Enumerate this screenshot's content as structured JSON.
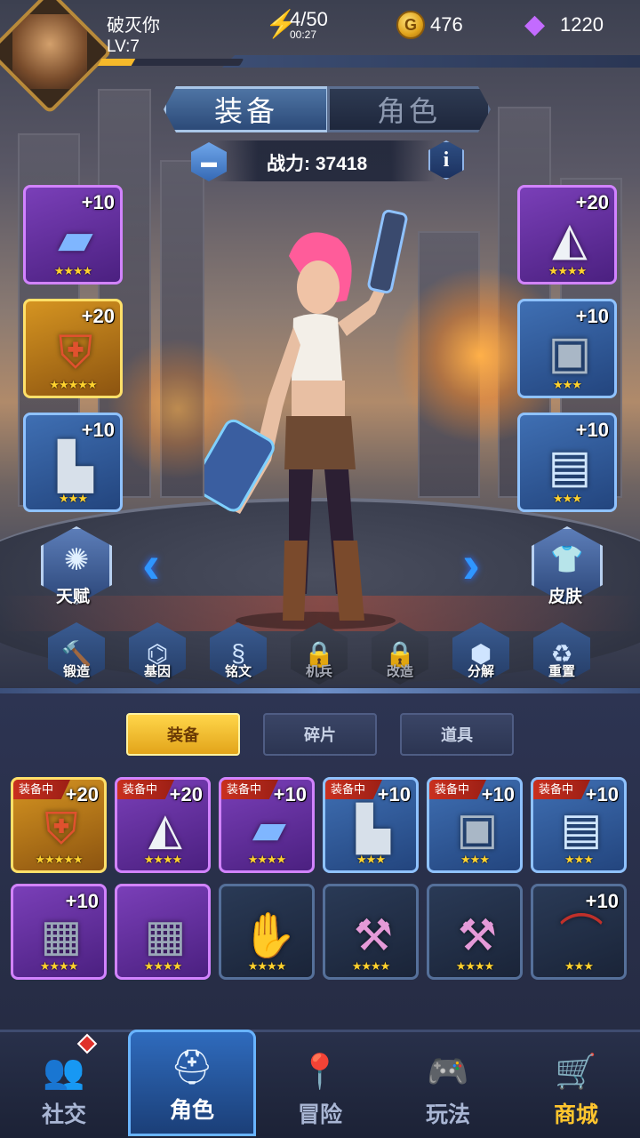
{
  "player": {
    "name": "破灭你",
    "level": "LV:7",
    "xp_fraction": 0.24
  },
  "resources": {
    "energy": {
      "value": "4/50",
      "timer": "00:27",
      "icon": "lightning-bolt-icon"
    },
    "gold": {
      "value": "476",
      "icon": "gold-coin-icon"
    },
    "gems": {
      "value": "1220",
      "icon": "purple-diamond-icon"
    }
  },
  "top_tabs": [
    {
      "label": "装备",
      "active": true
    },
    {
      "label": "角色",
      "active": false
    }
  ],
  "power": {
    "label": "战力:",
    "value": "37418"
  },
  "info_label": "i",
  "equipped_left": [
    {
      "plus": "+10",
      "stars": "★★★★",
      "quality": "purple",
      "item": "blaster-gun"
    },
    {
      "plus": "+20",
      "stars": "★★★★★",
      "quality": "gold",
      "item": "armor-vest"
    },
    {
      "plus": "+10",
      "stars": "★★★",
      "quality": "blue",
      "item": "boots"
    }
  ],
  "equipped_right": [
    {
      "plus": "+20",
      "stars": "★★★★",
      "quality": "purple",
      "item": "helmet"
    },
    {
      "plus": "+10",
      "stars": "★★★",
      "quality": "blue",
      "item": "gauntlet"
    },
    {
      "plus": "+10",
      "stars": "★★★",
      "quality": "blue",
      "item": "chip-card"
    }
  ],
  "side_buttons": {
    "talent": "天赋",
    "skin": "皮肤"
  },
  "actions": [
    {
      "label": "锻造",
      "icon": "hammer-icon",
      "locked": false
    },
    {
      "label": "基因",
      "icon": "dna-icon",
      "locked": false
    },
    {
      "label": "铭文",
      "icon": "inscription-icon",
      "locked": false
    },
    {
      "label": "机兵",
      "icon": "lock-icon",
      "locked": true
    },
    {
      "label": "改造",
      "icon": "lock-icon",
      "locked": true
    },
    {
      "label": "分解",
      "icon": "hexagons-icon",
      "locked": false
    },
    {
      "label": "重置",
      "icon": "recycle-icon",
      "locked": false
    }
  ],
  "inventory_tabs": [
    {
      "label": "装备",
      "active": true
    },
    {
      "label": "碎片",
      "active": false
    },
    {
      "label": "道具",
      "active": false
    }
  ],
  "equipped_tag": "装备中",
  "inventory": [
    {
      "plus": "+20",
      "stars": "★★★★★",
      "quality": "gold",
      "tagged": true,
      "item": "armor-vest"
    },
    {
      "plus": "+20",
      "stars": "★★★★",
      "quality": "purple",
      "tagged": true,
      "item": "helmet"
    },
    {
      "plus": "+10",
      "stars": "★★★★",
      "quality": "purple",
      "tagged": true,
      "item": "blaster-gun"
    },
    {
      "plus": "+10",
      "stars": "★★★",
      "quality": "blue",
      "tagged": true,
      "item": "boots"
    },
    {
      "plus": "+10",
      "stars": "★★★",
      "quality": "blue",
      "tagged": true,
      "item": "gauntlet"
    },
    {
      "plus": "+10",
      "stars": "★★★",
      "quality": "blue",
      "tagged": true,
      "item": "chip-card"
    },
    {
      "plus": "+10",
      "stars": "★★★★",
      "quality": "purple",
      "tagged": false,
      "item": "chest-armor"
    },
    {
      "plus": "",
      "stars": "★★★★",
      "quality": "purple",
      "tagged": false,
      "item": "chest-armor"
    },
    {
      "plus": "",
      "stars": "★★★★",
      "quality": "dark",
      "tagged": false,
      "item": "glove"
    },
    {
      "plus": "",
      "stars": "★★★★",
      "quality": "dark",
      "tagged": false,
      "item": "hammer"
    },
    {
      "plus": "",
      "stars": "★★★★",
      "quality": "dark",
      "tagged": false,
      "item": "hammer"
    },
    {
      "plus": "+10",
      "stars": "★★★",
      "quality": "dark",
      "tagged": false,
      "item": "bow"
    }
  ],
  "bottom_nav": [
    {
      "label": "社交",
      "icon": "social-icon",
      "active": false,
      "badge": true
    },
    {
      "label": "角色",
      "icon": "character-icon",
      "active": true,
      "badge": false
    },
    {
      "label": "冒险",
      "icon": "map-pin-icon",
      "active": false,
      "badge": false
    },
    {
      "label": "玩法",
      "icon": "gamepad-icon",
      "active": false,
      "badge": false
    },
    {
      "label": "商城",
      "icon": "shopping-cart-icon",
      "active": false,
      "badge": false
    }
  ]
}
